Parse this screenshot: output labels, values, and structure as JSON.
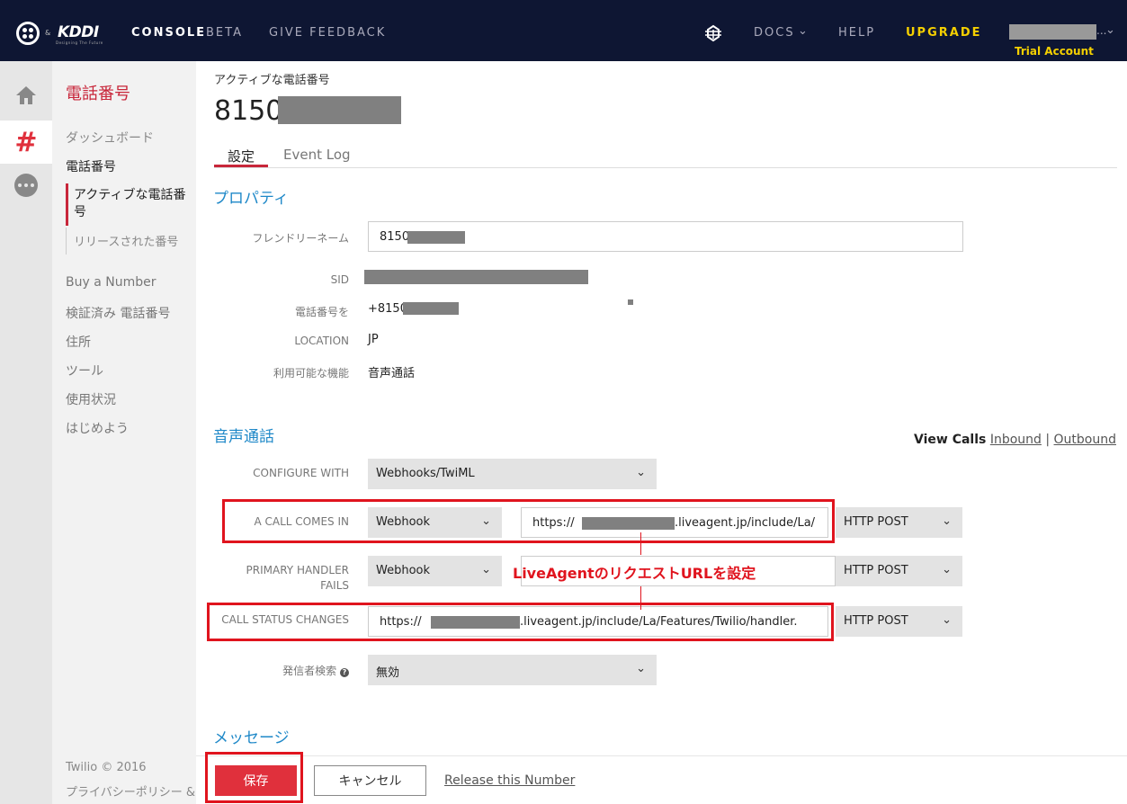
{
  "topbar": {
    "brand_secondary": "KDDI",
    "brand_secondary_tagline": "Designing The Future",
    "brand_amp": "&",
    "console": "CONSOLE",
    "beta": "BETA",
    "feedback": "GIVE FEEDBACK",
    "docs": "DOCS",
    "help": "HELP",
    "upgrade": "UPGRADE",
    "account_suffix": "...",
    "trial": "Trial Account",
    "accent_color": "#f5d000",
    "bg_color": "#0e1633"
  },
  "rail": {
    "items": [
      "home-icon",
      "phone-number-hash-icon",
      "more-icon"
    ],
    "hash_glyph": "#"
  },
  "sidebar": {
    "title": "電話番号",
    "dashboard": "ダッシュボード",
    "phone_numbers": "電話番号",
    "active_numbers": "アクティブな電話番号",
    "released_numbers": "リリースされた番号",
    "buy": "Buy a Number",
    "verified": "検証済み 電話番号",
    "address": "住所",
    "tools": "ツール",
    "usage": "使用状況",
    "getting_started": "はじめよう",
    "copyright": "Twilio © 2016",
    "privacy": "プライバシーポリシー &",
    "accent_color": "#c8263a"
  },
  "main": {
    "active_label": "アクティブな電話番号",
    "number_prefix": "8150",
    "tabs": [
      {
        "label": "設定"
      },
      {
        "label": "Event Log"
      }
    ],
    "properties": {
      "heading": "プロパティ",
      "friendly_name_label": "フレンドリーネーム",
      "friendly_name_value": "8150",
      "sid_label": "SID",
      "phone_label": "電話番号を",
      "phone_value": "+8150",
      "location_label": "LOCATION",
      "location_value": "JP",
      "features_label": "利用可能な機能",
      "features_value": "音声通話"
    },
    "voice": {
      "heading": "音声通話",
      "view_calls": "View Calls",
      "inbound": "Inbound",
      "separator": "|",
      "outbound": "Outbound",
      "configure_label": "CONFIGURE WITH",
      "configure_value": "Webhooks/TwiML",
      "call_in_label": "A CALL COMES IN",
      "call_in_type": "Webhook",
      "call_in_url_start": "https://",
      "call_in_url_end": ".liveagent.jp/include/La/",
      "call_in_method": "HTTP POST",
      "primary_label_1": "PRIMARY HANDLER",
      "primary_label_2": "FAILS",
      "primary_type": "Webhook",
      "primary_method": "HTTP POST",
      "status_label": "CALL STATUS CHANGES",
      "status_url_start": "https://",
      "status_url_end": ".liveagent.jp/include/La/Features/Twilio/handler.",
      "status_method": "HTTP POST",
      "caller_label": "発信者検索",
      "caller_help": "?",
      "caller_value": "無効",
      "chevron": "⌄"
    },
    "messages_heading": "メッセージ",
    "annotation": "LiveAgentのリクエストURLを設定",
    "annotation_color": "#e0141e",
    "link_color": "#1e88c8"
  },
  "footer": {
    "save": "保存",
    "cancel": "キャンセル",
    "release": "Release this Number"
  }
}
